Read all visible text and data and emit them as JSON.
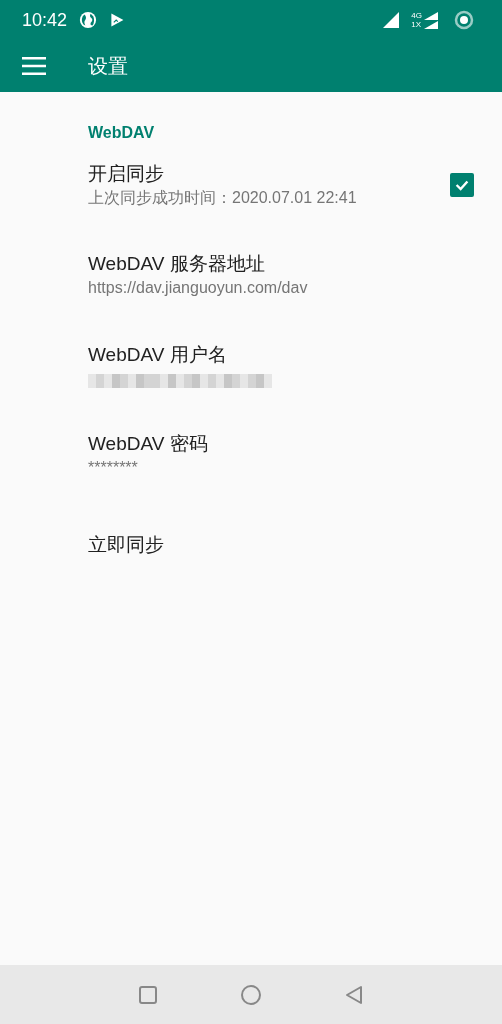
{
  "status_bar": {
    "time": "10:42",
    "network_top": "4G",
    "network_bottom": "1X"
  },
  "app_bar": {
    "title": "设置"
  },
  "section": {
    "title": "WebDAV"
  },
  "items": [
    {
      "kind": "checkbox",
      "title": "开启同步",
      "summary": "上次同步成功时间：2020.07.01 22:41",
      "checked": true
    },
    {
      "kind": "text",
      "title": "WebDAV 服务器地址",
      "summary": "https://dav.jianguoyun.com/dav"
    },
    {
      "kind": "redacted",
      "title": "WebDAV 用户名"
    },
    {
      "kind": "text",
      "title": "WebDAV 密码",
      "summary": "********"
    },
    {
      "kind": "plain",
      "title": "立即同步"
    }
  ]
}
